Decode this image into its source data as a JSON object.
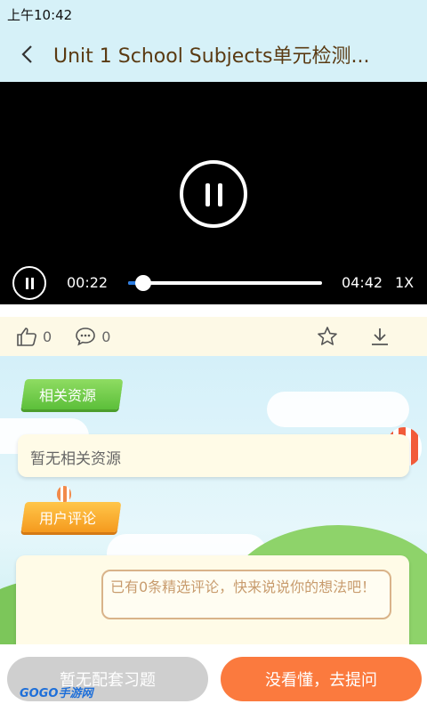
{
  "status_bar": {
    "time": "上午10:42"
  },
  "header": {
    "title": "Unit 1 School Subjects单元检测..."
  },
  "player": {
    "current_time": "00:22",
    "duration": "04:42",
    "speed": "1X",
    "progress": 0.078
  },
  "actions": {
    "like_count": "0",
    "comment_count": "0"
  },
  "related": {
    "tag": "相关资源",
    "empty_text": "暂无相关资源"
  },
  "comments": {
    "tag": "用户评论",
    "prompt": "已有0条精选评论，快来说说你的想法吧！"
  },
  "buttons": {
    "no_exercise": "暂无配套习题",
    "ask": "没看懂，去提问"
  },
  "watermark": "GOGO手游网",
  "colors": {
    "header_bg": "#d6f1f8",
    "accent_orange": "#fb7a3e",
    "title_brown": "#5a3a12"
  }
}
